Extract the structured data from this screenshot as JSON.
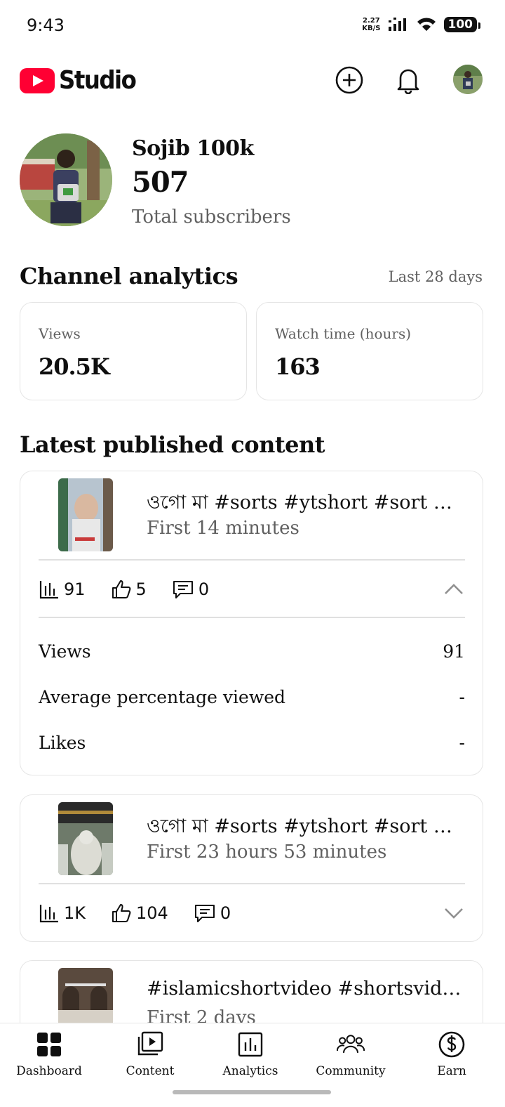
{
  "status_bar": {
    "time": "9:43",
    "net_speed_value": "2.27",
    "net_speed_unit": "KB/S",
    "battery": "100"
  },
  "header": {
    "logo_text": "Studio",
    "brand_color": "#ff0033",
    "icons": [
      "add-icon",
      "bell-icon"
    ]
  },
  "channel": {
    "name": "Sojib 100k",
    "subscribers": "507",
    "subscribers_label": "Total subscribers"
  },
  "analytics": {
    "title": "Channel analytics",
    "period": "Last 28 days",
    "cards": [
      {
        "label": "Views",
        "value": "20.5K"
      },
      {
        "label": "Watch time (hours)",
        "value": "163"
      }
    ]
  },
  "latest": {
    "title": "Latest published content",
    "items": [
      {
        "title": "ওগো মা #sorts #ytshort #sort #নবী…",
        "age": "First 14 minutes",
        "views": "91",
        "likes": "5",
        "comments": "0",
        "expanded": true,
        "details": [
          {
            "label": "Views",
            "value": "91"
          },
          {
            "label": "Average percentage viewed",
            "value": "-"
          },
          {
            "label": "Likes",
            "value": "-"
          }
        ]
      },
      {
        "title": "ওগো মা #sorts #ytshort #sort #নবী…",
        "age": "First 23 hours 53 minutes",
        "views": "1K",
        "likes": "104",
        "comments": "0",
        "expanded": false
      },
      {
        "title": "#islamicshortvideo #shortsvideo #all…",
        "age": "First 2 days"
      }
    ]
  },
  "nav": [
    {
      "label": "Dashboard",
      "icon": "dashboard-icon",
      "active": true
    },
    {
      "label": "Content",
      "icon": "content-icon"
    },
    {
      "label": "Analytics",
      "icon": "analytics-icon"
    },
    {
      "label": "Community",
      "icon": "community-icon"
    },
    {
      "label": "Earn",
      "icon": "earn-dollar-icon"
    }
  ]
}
